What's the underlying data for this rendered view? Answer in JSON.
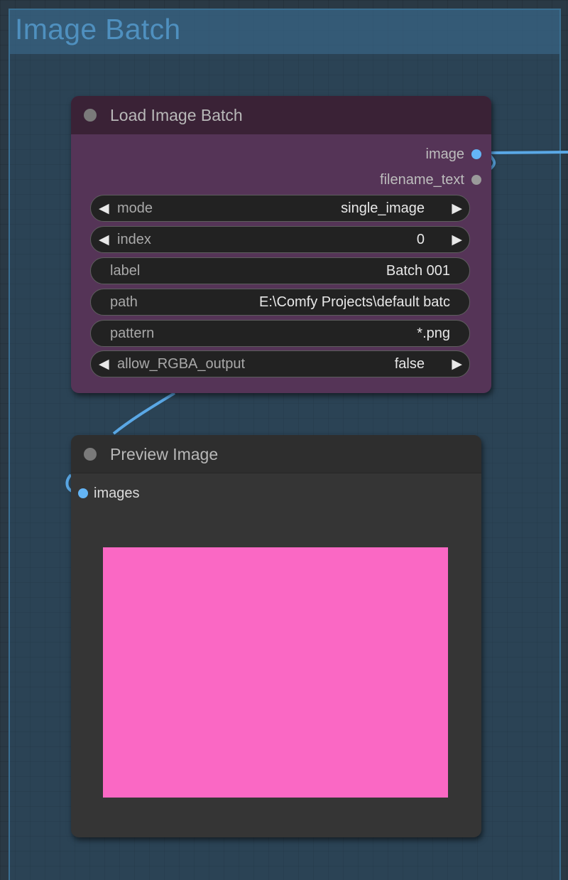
{
  "group": {
    "title": "Image Batch"
  },
  "load_node": {
    "title": "Load Image Batch",
    "outputs": [
      {
        "name": "image",
        "type_color": "#64b5f6"
      },
      {
        "name": "filename_text",
        "type_color": "#9a9a9a"
      }
    ],
    "widgets": [
      {
        "name": "mode",
        "value": "single_image",
        "kind": "combo"
      },
      {
        "name": "index",
        "value": "0",
        "kind": "number"
      },
      {
        "name": "label",
        "value": "Batch 001",
        "kind": "text"
      },
      {
        "name": "path",
        "value": "E:\\Comfy Projects\\default batc",
        "kind": "text"
      },
      {
        "name": "pattern",
        "value": "*.png",
        "kind": "text"
      },
      {
        "name": "allow_RGBA_output",
        "value": "false",
        "kind": "combo"
      }
    ],
    "color": "#553457"
  },
  "preview_node": {
    "title": "Preview Image",
    "inputs": [
      {
        "name": "images",
        "type_color": "#64b5f6"
      }
    ],
    "image_color": "#fa68c4"
  },
  "icons": {
    "arrow_left": "◀",
    "arrow_right": "▶"
  }
}
